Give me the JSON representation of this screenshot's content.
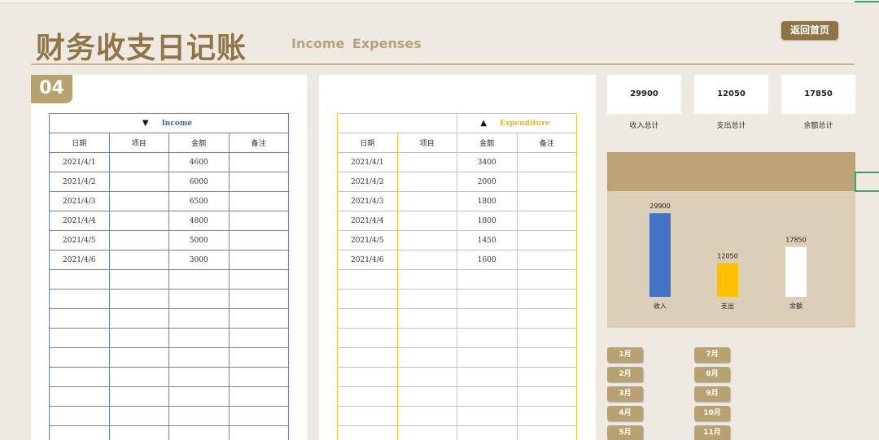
{
  "header": {
    "title": "财务收支日记账",
    "subtitle": "Income  Expenses",
    "home_button": "返回首页",
    "month_badge": "04"
  },
  "income_table": {
    "arrow": "▼",
    "label": "Income",
    "columns": [
      "日期",
      "项目",
      "金额",
      "备注"
    ],
    "rows": [
      [
        "2021/4/1",
        "",
        "4600",
        ""
      ],
      [
        "2021/4/2",
        "",
        "6000",
        ""
      ],
      [
        "2021/4/3",
        "",
        "6500",
        ""
      ],
      [
        "2021/4/4",
        "",
        "4800",
        ""
      ],
      [
        "2021/4/5",
        "",
        "5000",
        ""
      ],
      [
        "2021/4/6",
        "",
        "3000",
        ""
      ]
    ]
  },
  "expense_table": {
    "arrow": "▲",
    "label": "Expenditure",
    "columns": [
      "日期",
      "项目",
      "金额",
      "备注"
    ],
    "rows": [
      [
        "2021/4/1",
        "",
        "3400",
        ""
      ],
      [
        "2021/4/2",
        "",
        "2000",
        ""
      ],
      [
        "2021/4/3",
        "",
        "1800",
        ""
      ],
      [
        "2021/4/4",
        "",
        "1800",
        ""
      ],
      [
        "2021/4/5",
        "",
        "1450",
        ""
      ],
      [
        "2021/4/6",
        "",
        "1600",
        ""
      ]
    ]
  },
  "summary": [
    {
      "value": "29900",
      "label": "收入总计"
    },
    {
      "value": "12050",
      "label": "支出总计"
    },
    {
      "value": "17850",
      "label": "余额总计"
    }
  ],
  "chart_data": {
    "type": "bar",
    "categories": [
      "收入",
      "支出",
      "余额"
    ],
    "values": [
      29900,
      12050,
      17850
    ],
    "colors": [
      "#4472c4",
      "#ffc000",
      "#ffffff"
    ],
    "title": "",
    "xlabel": "",
    "ylabel": ""
  },
  "months": {
    "left": [
      "1月",
      "2月",
      "3月",
      "4月",
      "5月"
    ],
    "right": [
      "7月",
      "8月",
      "9月",
      "10月",
      "11月"
    ]
  },
  "colors": {
    "brand_dark": "#8e7346",
    "brand": "#b9a272",
    "income_border": "#5e86c2",
    "expense_border": "#f1c734"
  }
}
